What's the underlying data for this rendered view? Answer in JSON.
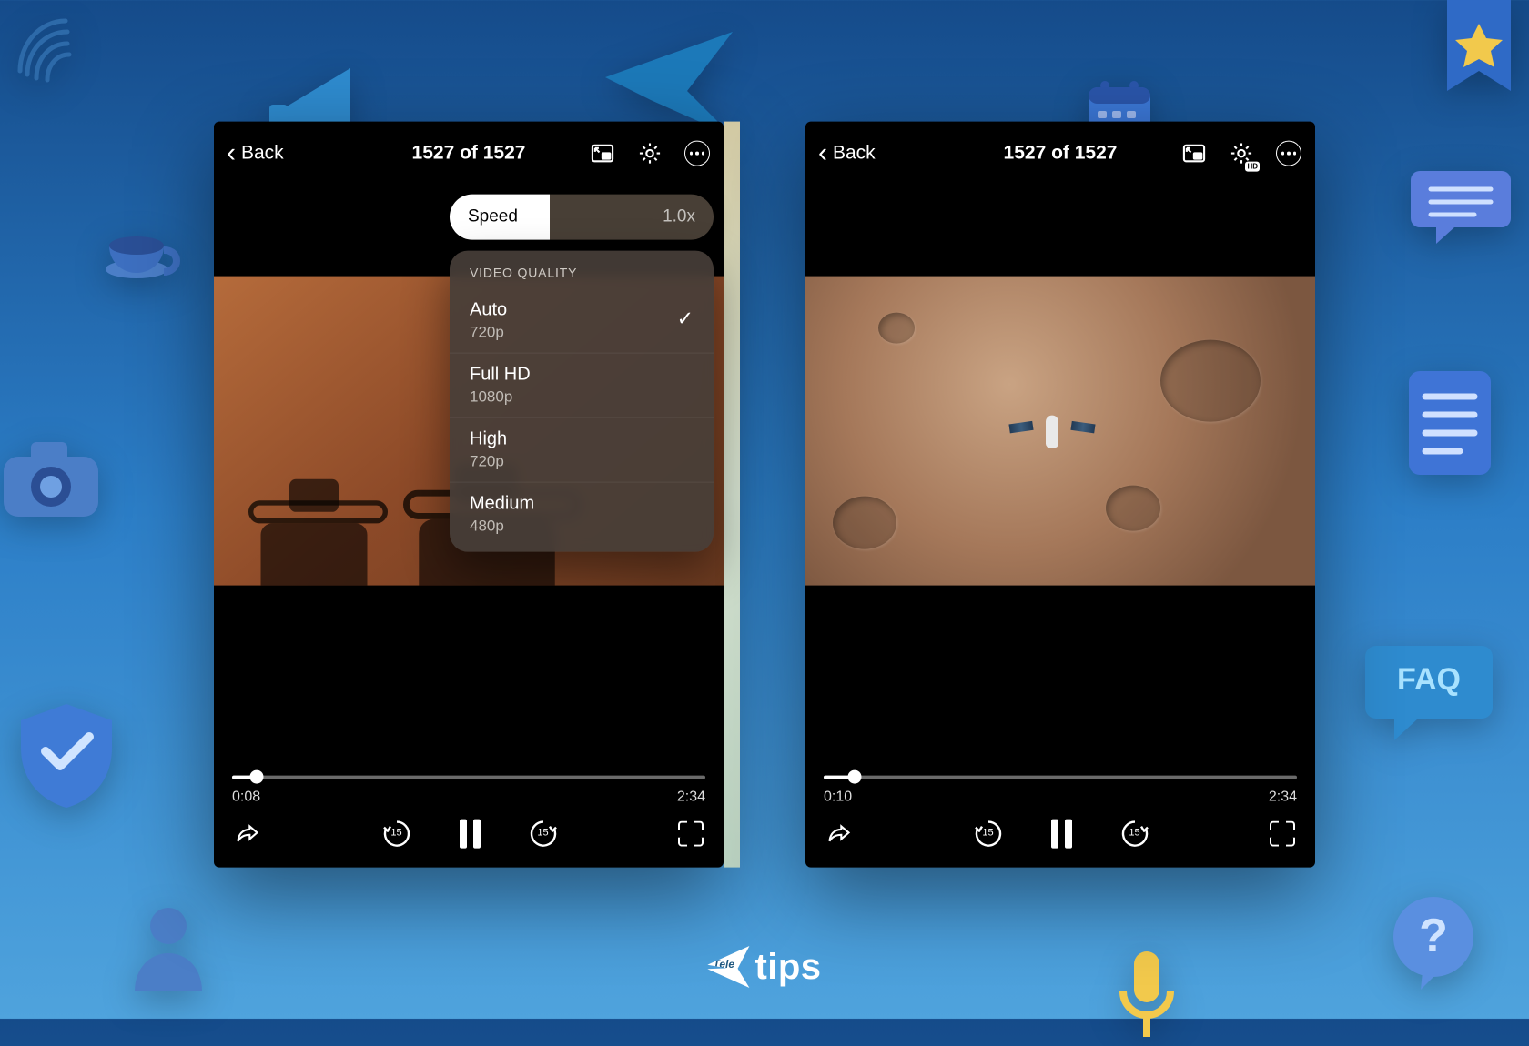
{
  "brand": {
    "prefix": "Tele",
    "word": "tips"
  },
  "player": {
    "back_label": "Back",
    "counter": "1527 of 1527",
    "hd_badge": "HD"
  },
  "settings": {
    "speed_label": "Speed",
    "speed_value": "1.0x",
    "quality_header": "VIDEO QUALITY",
    "options": [
      {
        "label": "Auto",
        "sub": "720p",
        "selected": true
      },
      {
        "label": "Full HD",
        "sub": "1080p",
        "selected": false
      },
      {
        "label": "High",
        "sub": "720p",
        "selected": false
      },
      {
        "label": "Medium",
        "sub": "480p",
        "selected": false
      }
    ]
  },
  "left": {
    "current": "0:08",
    "duration": "2:34",
    "progress_pct": 5.2
  },
  "right": {
    "current": "0:10",
    "duration": "2:34",
    "progress_pct": 6.5
  },
  "skip_seconds": "15"
}
